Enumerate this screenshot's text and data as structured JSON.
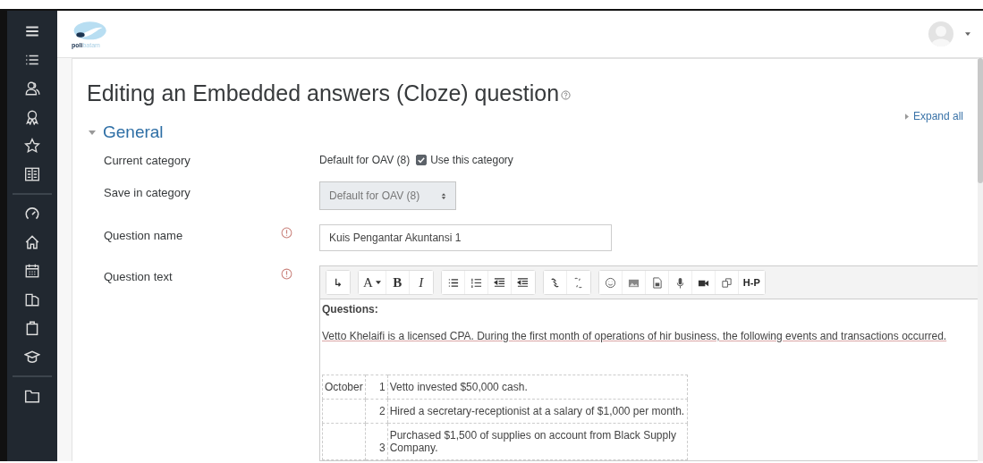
{
  "logo": {
    "prefix": "poli",
    "suffix": "batam"
  },
  "page_title": "Editing an Embedded answers (Cloze) question",
  "expand_all": "Expand all",
  "section": {
    "title": "General",
    "expanded": true
  },
  "fields": [
    {
      "kind": "static",
      "label": "Current category",
      "value": "Default for OAV (8)",
      "checkbox": {
        "label": "Use this category",
        "checked": true
      }
    },
    {
      "kind": "select",
      "label": "Save in category",
      "value": "Default for OAV (8)",
      "disabled": true
    },
    {
      "kind": "text",
      "label": "Question name",
      "required": true,
      "value": "Kuis Pengantar Akuntansi 1"
    },
    {
      "kind": "editor",
      "label": "Question text",
      "required": true
    }
  ],
  "toolbar": {
    "font_button": "A",
    "bold_button": "B",
    "italic_button": "I",
    "h5p_button": "H-P"
  },
  "editor": {
    "heading": "Questions:",
    "paragraph": "Vetto Khelaifi is a licensed CPA. During the first month of operations of hir business, the following events and transactions occurred.",
    "rows": [
      {
        "month": "October",
        "day": "1",
        "text": "Vetto invested $50,000 cash."
      },
      {
        "day": "2",
        "text": "Hired a secretary-receptionist at a salary of $1,000 per month."
      },
      {
        "day": "3",
        "text": "Purchased $1,500 of supplies on account from Black Supply Company."
      }
    ]
  }
}
